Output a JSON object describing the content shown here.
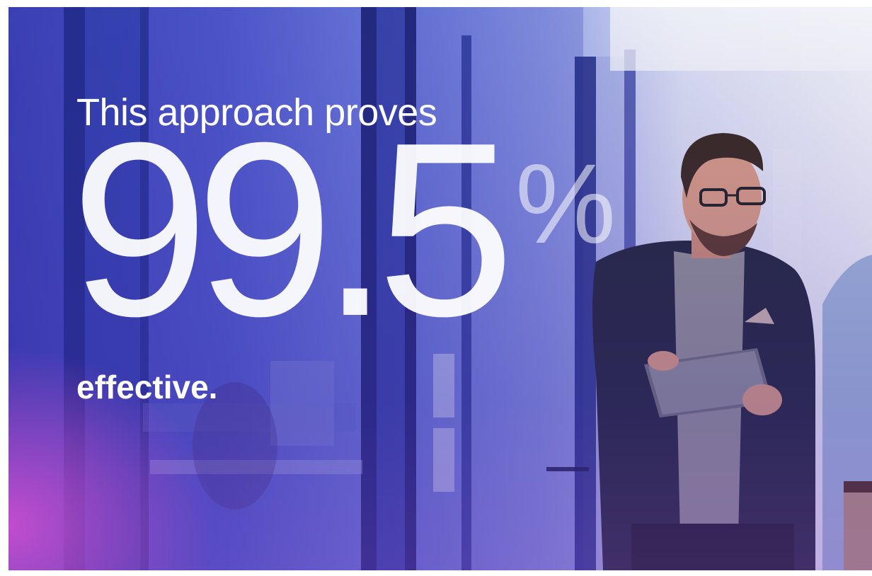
{
  "headline": {
    "line1": "This approach proves",
    "number": "99.5",
    "unit": "%",
    "line3": "effective."
  },
  "colors": {
    "text": "#ffffff",
    "background_left": "#3a3fb2",
    "accent_magenta": "#d650d2",
    "background_right": "#eef0f6"
  },
  "scene": {
    "icons": [
      "office-background",
      "person-with-tablet",
      "person-partial"
    ]
  }
}
